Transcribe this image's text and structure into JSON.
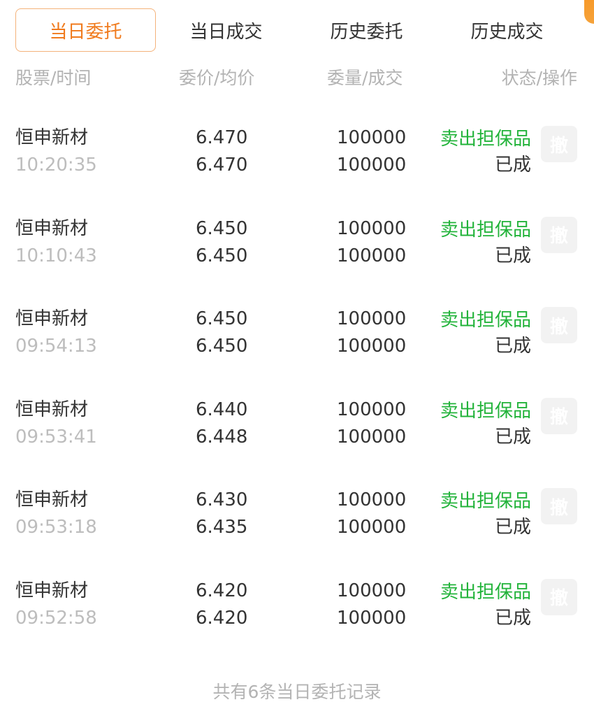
{
  "tabs": [
    {
      "label": "当日委托",
      "active": true
    },
    {
      "label": "当日成交",
      "active": false
    },
    {
      "label": "历史委托",
      "active": false
    },
    {
      "label": "历史成交",
      "active": false
    }
  ],
  "columns": {
    "stock_time": "股票/时间",
    "price_avg": "委价/均价",
    "qty_filled": "委量/成交",
    "status_op": "状态/操作"
  },
  "orders": [
    {
      "name": "恒申新材",
      "time": "10:20:35",
      "order_price": "6.470",
      "avg_price": "6.470",
      "order_qty": "100000",
      "filled_qty": "100000",
      "type": "卖出担保品",
      "status": "已成",
      "cancel_label": "撤"
    },
    {
      "name": "恒申新材",
      "time": "10:10:43",
      "order_price": "6.450",
      "avg_price": "6.450",
      "order_qty": "100000",
      "filled_qty": "100000",
      "type": "卖出担保品",
      "status": "已成",
      "cancel_label": "撤"
    },
    {
      "name": "恒申新材",
      "time": "09:54:13",
      "order_price": "6.450",
      "avg_price": "6.450",
      "order_qty": "100000",
      "filled_qty": "100000",
      "type": "卖出担保品",
      "status": "已成",
      "cancel_label": "撤"
    },
    {
      "name": "恒申新材",
      "time": "09:53:41",
      "order_price": "6.440",
      "avg_price": "6.448",
      "order_qty": "100000",
      "filled_qty": "100000",
      "type": "卖出担保品",
      "status": "已成",
      "cancel_label": "撤"
    },
    {
      "name": "恒申新材",
      "time": "09:53:18",
      "order_price": "6.430",
      "avg_price": "6.435",
      "order_qty": "100000",
      "filled_qty": "100000",
      "type": "卖出担保品",
      "status": "已成",
      "cancel_label": "撤"
    },
    {
      "name": "恒申新材",
      "time": "09:52:58",
      "order_price": "6.420",
      "avg_price": "6.420",
      "order_qty": "100000",
      "filled_qty": "100000",
      "type": "卖出担保品",
      "status": "已成",
      "cancel_label": "撤"
    }
  ],
  "footer": "共有6条当日委托记录",
  "colors": {
    "accent": "#f07a1c",
    "sell_type": "#22b33a",
    "muted": "#b3b3b3"
  }
}
